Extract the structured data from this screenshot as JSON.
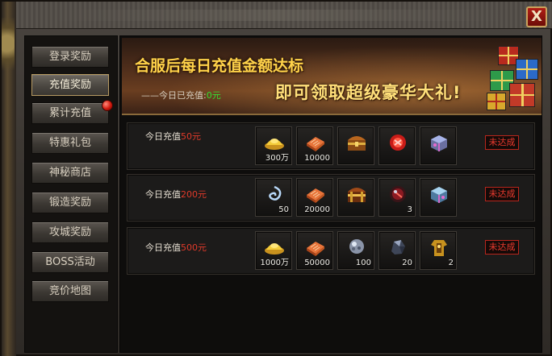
{
  "window": {
    "close_label": "X"
  },
  "sidebar": {
    "items": [
      {
        "label": "登录奖励",
        "active": false,
        "badge": false
      },
      {
        "label": "充值奖励",
        "active": true,
        "badge": false
      },
      {
        "label": "累计充值",
        "active": false,
        "badge": true
      },
      {
        "label": "特惠礼包",
        "active": false,
        "badge": false
      },
      {
        "label": "神秘商店",
        "active": false,
        "badge": false
      },
      {
        "label": "锻造奖励",
        "active": false,
        "badge": false
      },
      {
        "label": "攻城奖励",
        "active": false,
        "badge": false
      },
      {
        "label": "BOSS活动",
        "active": false,
        "badge": false
      },
      {
        "label": "竞价地图",
        "active": false,
        "badge": false
      }
    ]
  },
  "banner": {
    "title": "合服后每日充值金额达标",
    "subtitle": "即可领取超级豪华大礼!",
    "today_label": "——今日已充值:",
    "today_value": "0元"
  },
  "tiers": [
    {
      "label": "今日充值",
      "amount": "50元",
      "status": "未达成",
      "rewards": [
        {
          "icon": "gold-ingot-icon",
          "qty": "300万"
        },
        {
          "icon": "scroll-book-icon",
          "qty": "10000"
        },
        {
          "icon": "treasure-chest-icon",
          "qty": ""
        },
        {
          "icon": "red-gem-icon",
          "qty": ""
        },
        {
          "icon": "crystal-box-icon",
          "qty": ""
        }
      ]
    },
    {
      "label": "今日充值",
      "amount": "200元",
      "status": "未达成",
      "rewards": [
        {
          "icon": "swirl-orb-icon",
          "qty": "50"
        },
        {
          "icon": "scroll-book-icon",
          "qty": "20000"
        },
        {
          "icon": "treasure-chest-icon",
          "qty": ""
        },
        {
          "icon": "dark-orb-icon",
          "qty": "3"
        },
        {
          "icon": "crystal-box-icon",
          "qty": ""
        }
      ]
    },
    {
      "label": "今日充值",
      "amount": "500元",
      "status": "未达成",
      "rewards": [
        {
          "icon": "gold-ingot-icon",
          "qty": "1000万"
        },
        {
          "icon": "scroll-book-icon",
          "qty": "50000"
        },
        {
          "icon": "silver-ore-icon",
          "qty": "100"
        },
        {
          "icon": "dark-stone-icon",
          "qty": "20"
        },
        {
          "icon": "golden-armor-icon",
          "qty": "2"
        }
      ]
    }
  ],
  "colors": {
    "accent_gold": "#ffd34a",
    "status_red": "#e93a2e",
    "today_green": "#32e032",
    "amount_red": "#e03a2a"
  }
}
